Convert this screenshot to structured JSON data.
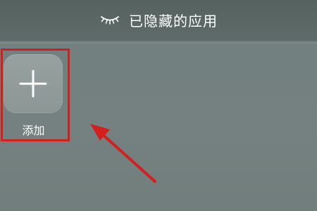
{
  "header": {
    "title": "已隐藏的应用",
    "icon": "closed-eye-icon"
  },
  "main": {
    "add_button": {
      "label": "添加",
      "icon": "plus-icon"
    }
  },
  "annotations": {
    "highlight_color": "#d41f1f",
    "arrow_color": "#d41f1f"
  }
}
